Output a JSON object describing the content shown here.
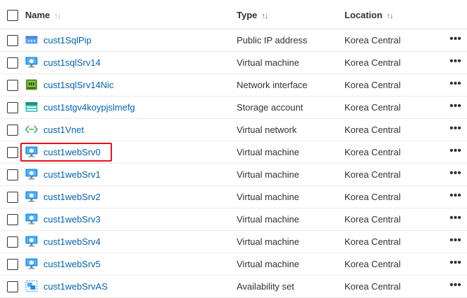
{
  "header": {
    "name_label": "Name",
    "type_label": "Type",
    "location_label": "Location",
    "name_sort_glyph": "↑↓",
    "type_sort_glyph": "↑↓",
    "location_sort_glyph": "↑↓"
  },
  "more_glyph": "•••",
  "rows": [
    {
      "name": "cust1SqlPip",
      "type": "Public IP address",
      "location": "Korea Central",
      "icon": "public-ip-icon"
    },
    {
      "name": "cust1sqlSrv14",
      "type": "Virtual machine",
      "location": "Korea Central",
      "icon": "virtual-machine-icon"
    },
    {
      "name": "cust1sqlSrv14Nic",
      "type": "Network interface",
      "location": "Korea Central",
      "icon": "network-interface-icon"
    },
    {
      "name": "cust1stgv4koypjslmefg",
      "type": "Storage account",
      "location": "Korea Central",
      "icon": "storage-account-icon"
    },
    {
      "name": "cust1Vnet",
      "type": "Virtual network",
      "location": "Korea Central",
      "icon": "virtual-network-icon"
    },
    {
      "name": "cust1webSrv0",
      "type": "Virtual machine",
      "location": "Korea Central",
      "icon": "virtual-machine-icon",
      "highlighted": true
    },
    {
      "name": "cust1webSrv1",
      "type": "Virtual machine",
      "location": "Korea Central",
      "icon": "virtual-machine-icon"
    },
    {
      "name": "cust1webSrv2",
      "type": "Virtual machine",
      "location": "Korea Central",
      "icon": "virtual-machine-icon"
    },
    {
      "name": "cust1webSrv3",
      "type": "Virtual machine",
      "location": "Korea Central",
      "icon": "virtual-machine-icon"
    },
    {
      "name": "cust1webSrv4",
      "type": "Virtual machine",
      "location": "Korea Central",
      "icon": "virtual-machine-icon"
    },
    {
      "name": "cust1webSrv5",
      "type": "Virtual machine",
      "location": "Korea Central",
      "icon": "virtual-machine-icon"
    },
    {
      "name": "cust1webSrvAS",
      "type": "Availability set",
      "location": "Korea Central",
      "icon": "availability-set-icon"
    }
  ],
  "colors": {
    "link": "#0063b1",
    "highlight": "#e8111b",
    "text": "#323130"
  }
}
